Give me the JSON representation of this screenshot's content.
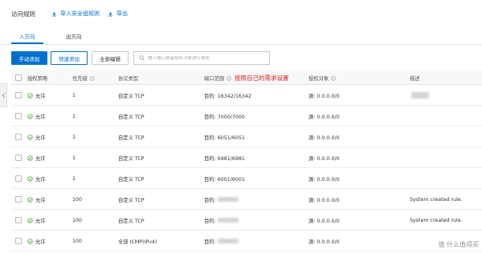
{
  "header": {
    "title": "访问规则",
    "import_label": "导入安全组规则",
    "export_label": "导出"
  },
  "tabs": [
    {
      "label": "入方向",
      "active": true
    },
    {
      "label": "出方向",
      "active": false
    }
  ],
  "toolbar": {
    "manual_add": "手动添加",
    "quick_add": "快速添加",
    "edit_all": "全部编辑",
    "search_placeholder": "输入端口或者授权对象进行搜索"
  },
  "annotation": "按照自己的需求设置",
  "table": {
    "columns": {
      "policy": "授权策略",
      "priority": "优先级",
      "protocol": "协议类型",
      "port": "端口范围",
      "auth": "授权对象",
      "desc": "描述"
    },
    "rows": [
      {
        "policy": "允许",
        "priority": "1",
        "protocol": "自定义 TCP",
        "port": "目的: 16342/16342",
        "auth": "源: 0.0.0.0/0",
        "desc": ""
      },
      {
        "policy": "允许",
        "priority": "1",
        "protocol": "自定义 TCP",
        "port": "目的: 7000/7000",
        "auth": "源: 0.0.0.0/0",
        "desc": ""
      },
      {
        "policy": "允许",
        "priority": "1",
        "protocol": "自定义 TCP",
        "port": "目的: 6051/6051",
        "auth": "源: 0.0.0.0/0",
        "desc": ""
      },
      {
        "policy": "允许",
        "priority": "1",
        "protocol": "自定义 TCP",
        "port": "目的: 6981/6981",
        "auth": "源: 0.0.0.0/0",
        "desc": ""
      },
      {
        "policy": "允许",
        "priority": "1",
        "protocol": "自定义 TCP",
        "port": "目的: 6001/6001",
        "auth": "源: 0.0.0.0/0",
        "desc": ""
      },
      {
        "policy": "允许",
        "priority": "100",
        "protocol": "自定义 TCP",
        "port": "目的:",
        "auth": "源: 0.0.0.0/0",
        "desc": "System created rule."
      },
      {
        "policy": "允许",
        "priority": "100",
        "protocol": "自定义 TCP",
        "port": "目的:",
        "auth": "源: 0.0.0.0/0",
        "desc": "System created rule."
      },
      {
        "policy": "允许",
        "priority": "100",
        "protocol": "全部 ICMP(IPv4)",
        "port": "目的:",
        "auth": "源: 0.0.0.0/0",
        "desc": ""
      }
    ]
  },
  "watermark": "值 什么值得买",
  "colors": {
    "accent": "#0070cc",
    "annotation": "#e02020",
    "allow": "#2aa515"
  }
}
